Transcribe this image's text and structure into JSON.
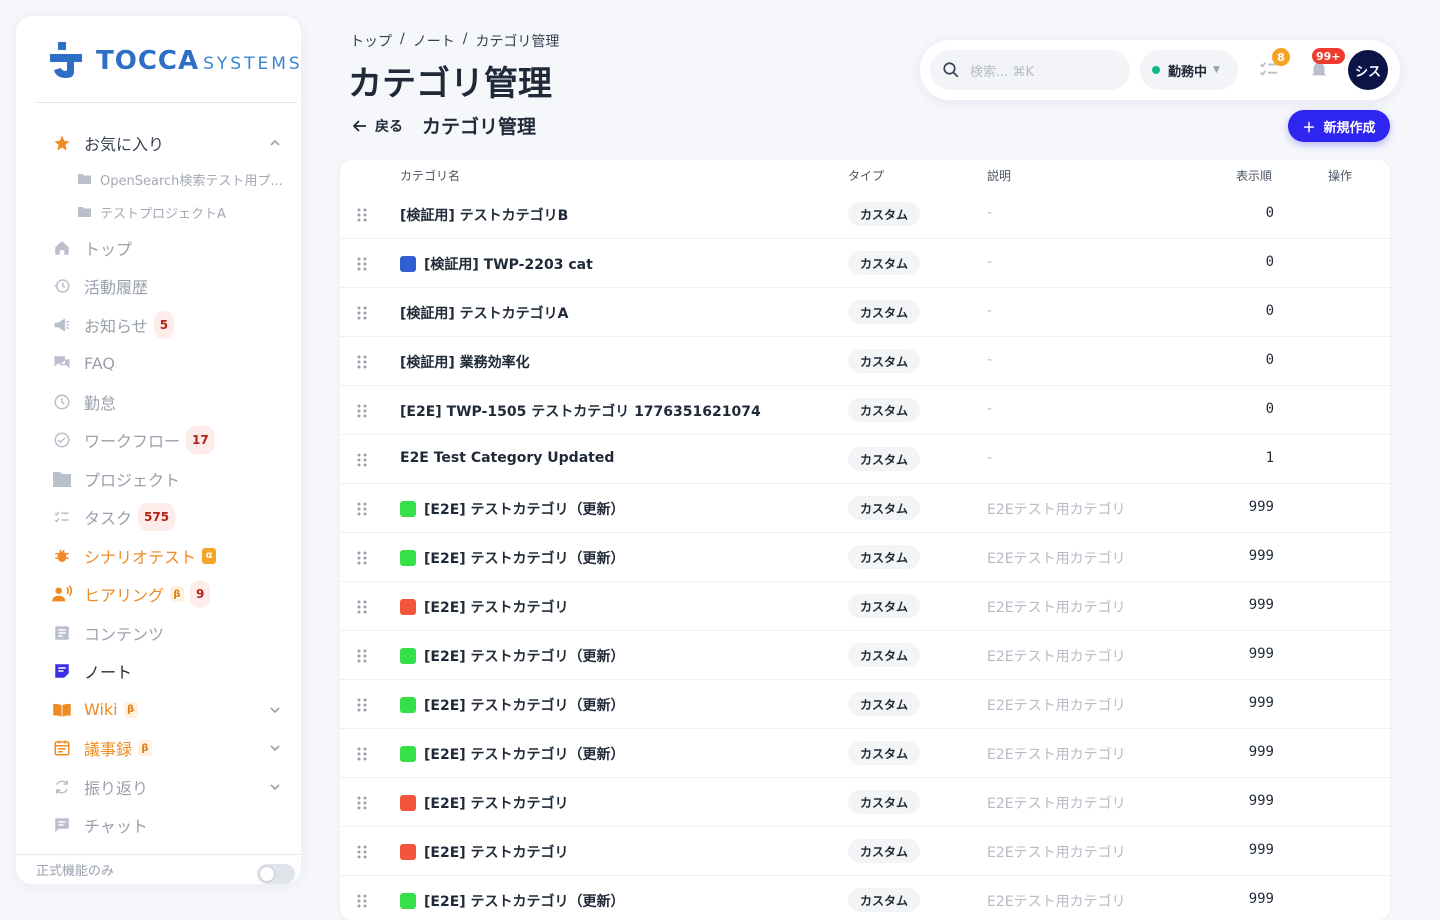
{
  "brand": {
    "name": "TOCCA",
    "suffix": "SYSTEMS",
    "color": "#2d6fc4"
  },
  "sidebar": {
    "favorites": {
      "label": "お気に入り",
      "icon": "star-icon",
      "items": [
        {
          "label": "OpenSearch検索テスト用プ...",
          "icon": "folder-icon"
        },
        {
          "label": "テストプロジェクトA",
          "icon": "folder-icon"
        }
      ]
    },
    "items": [
      {
        "label": "トップ",
        "icon": "home-icon"
      },
      {
        "label": "活動履歴",
        "icon": "history-icon"
      },
      {
        "label": "お知らせ",
        "icon": "megaphone-icon",
        "badge": "5"
      },
      {
        "label": "FAQ",
        "icon": "forum-icon"
      },
      {
        "label": "勤怠",
        "icon": "clock-icon"
      },
      {
        "label": "ワークフロー",
        "icon": "check-circle-icon",
        "badge": "17"
      },
      {
        "label": "プロジェクト",
        "icon": "folder-icon"
      },
      {
        "label": "タスク",
        "icon": "checklist-icon",
        "badge": "575"
      },
      {
        "label": "シナリオテスト",
        "icon": "bug-icon",
        "tag": "α"
      },
      {
        "label": "ヒアリング",
        "icon": "voice-user-icon",
        "tag": "β",
        "badge": "9"
      },
      {
        "label": "コンテンツ",
        "icon": "article-icon"
      },
      {
        "label": "ノート",
        "icon": "note-icon"
      },
      {
        "label": "Wiki",
        "icon": "book-icon",
        "tag": "β"
      },
      {
        "label": "議事録",
        "icon": "calendar-icon",
        "tag": "β"
      },
      {
        "label": "振り返り",
        "icon": "refresh-icon"
      },
      {
        "label": "チャット",
        "icon": "chat-icon"
      }
    ],
    "footer": {
      "label": "正式機能のみ",
      "toggle_on": false
    }
  },
  "breadcrumb": [
    "トップ",
    "ノート",
    "カテゴリ管理"
  ],
  "breadcrumb_sep": "/",
  "page_title": "カテゴリ管理",
  "topbar": {
    "search_placeholder": "検索... ⌘K",
    "status_label": "勤務中",
    "tasks_count": "8",
    "notifications_count": "99+",
    "avatar_initials": "シス"
  },
  "header": {
    "back_label": "戻る",
    "section_title": "カテゴリ管理",
    "new_button": "新規作成"
  },
  "table": {
    "columns": [
      "カテゴリ名",
      "タイプ",
      "説明",
      "表示順",
      "操作"
    ],
    "rows": [
      {
        "name": "[検証用] テストカテゴリB",
        "color": null,
        "type": "カスタム",
        "desc": "-",
        "order": "0"
      },
      {
        "name": "[検証用] TWP-2203 cat",
        "color": "#2f5fd0",
        "type": "カスタム",
        "desc": "-",
        "order": "0"
      },
      {
        "name": "[検証用] テストカテゴリA",
        "color": null,
        "type": "カスタム",
        "desc": "-",
        "order": "0"
      },
      {
        "name": "[検証用] 業務効率化",
        "color": null,
        "type": "カスタム",
        "desc": "-",
        "order": "0"
      },
      {
        "name": "[E2E] TWP-1505 テストカテゴリ 1776351621074",
        "color": null,
        "type": "カスタム",
        "desc": "-",
        "order": "0"
      },
      {
        "name": "E2E Test Category Updated",
        "color": null,
        "type": "カスタム",
        "desc": "-",
        "order": "1"
      },
      {
        "name": "[E2E] テストカテゴリ（更新）",
        "color": "#35e04a",
        "type": "カスタム",
        "desc": "E2Eテスト用カテゴリ",
        "order": "999"
      },
      {
        "name": "[E2E] テストカテゴリ（更新）",
        "color": "#35e04a",
        "type": "カスタム",
        "desc": "E2Eテスト用カテゴリ",
        "order": "999"
      },
      {
        "name": "[E2E] テストカテゴリ",
        "color": "#f4543c",
        "type": "カスタム",
        "desc": "E2Eテスト用カテゴリ",
        "order": "999"
      },
      {
        "name": "[E2E] テストカテゴリ（更新）",
        "color": "#35e04a",
        "type": "カスタム",
        "desc": "E2Eテスト用カテゴリ",
        "order": "999"
      },
      {
        "name": "[E2E] テストカテゴリ（更新）",
        "color": "#35e04a",
        "type": "カスタム",
        "desc": "E2Eテスト用カテゴリ",
        "order": "999"
      },
      {
        "name": "[E2E] テストカテゴリ（更新）",
        "color": "#35e04a",
        "type": "カスタム",
        "desc": "E2Eテスト用カテゴリ",
        "order": "999"
      },
      {
        "name": "[E2E] テストカテゴリ",
        "color": "#f4543c",
        "type": "カスタム",
        "desc": "E2Eテスト用カテゴリ",
        "order": "999"
      },
      {
        "name": "[E2E] テストカテゴリ",
        "color": "#f4543c",
        "type": "カスタム",
        "desc": "E2Eテスト用カテゴリ",
        "order": "999"
      },
      {
        "name": "[E2E] テストカテゴリ（更新）",
        "color": "#35e04a",
        "type": "カスタム",
        "desc": "E2Eテスト用カテゴリ",
        "order": "999"
      }
    ]
  },
  "colors": {
    "accent": "#2f25f0",
    "brand": "#2d6fc4",
    "badge_bg": "#fdecea",
    "online": "#10b981"
  }
}
